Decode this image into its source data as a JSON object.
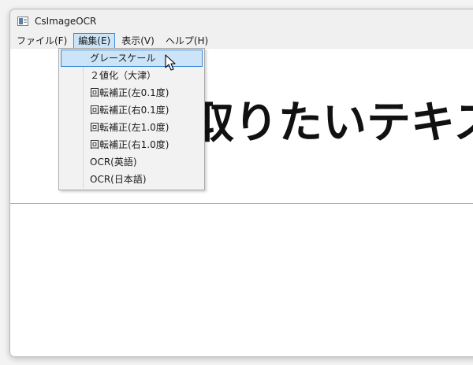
{
  "window": {
    "title": "CsImageOCR"
  },
  "menubar": {
    "items": [
      {
        "label": "ファイル(F)"
      },
      {
        "label": "編集(E)"
      },
      {
        "label": "表示(V)"
      },
      {
        "label": "ヘルプ(H)"
      }
    ]
  },
  "image": {
    "text": "取りたいテキスト"
  },
  "edit_menu": {
    "items": [
      {
        "label": "グレースケール"
      },
      {
        "label": "２値化（大津）"
      },
      {
        "label": "回転補正(左0.1度)"
      },
      {
        "label": "回転補正(右0.1度)"
      },
      {
        "label": "回転補正(左1.0度)"
      },
      {
        "label": "回転補正(右1.0度)"
      },
      {
        "label": "OCR(英語)"
      },
      {
        "label": "OCR(日本語)"
      }
    ]
  },
  "colors": {
    "accent": "#3c8ad6",
    "highlight": "#cce4f7"
  }
}
